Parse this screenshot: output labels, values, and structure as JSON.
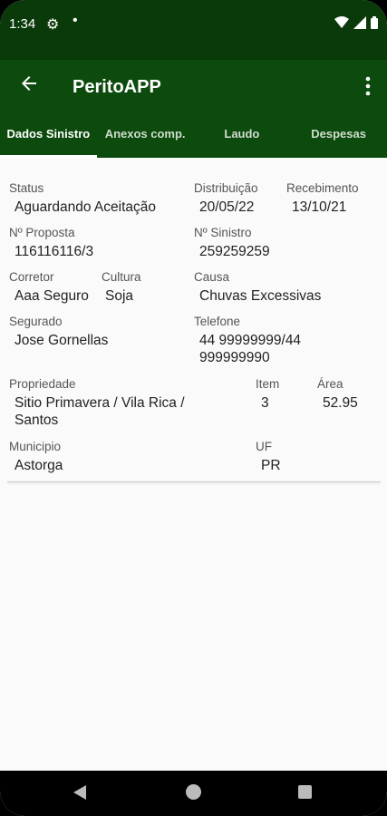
{
  "status_bar": {
    "time": "1:34"
  },
  "app_bar": {
    "title": "PeritoAPP"
  },
  "tabs": [
    {
      "label": "Dados Sinistro",
      "active": true
    },
    {
      "label": "Anexos comp."
    },
    {
      "label": "Laudo"
    },
    {
      "label": "Despesas"
    }
  ],
  "fields": {
    "status": {
      "label": "Status",
      "value": "Aguardando Aceitação"
    },
    "distribuicao": {
      "label": "Distribuição",
      "value": "20/05/22"
    },
    "recebimento": {
      "label": "Recebimento",
      "value": "13/10/21"
    },
    "proposta": {
      "label": "Nº Proposta",
      "value": "116116116/3"
    },
    "sinistro": {
      "label": "Nº Sinistro",
      "value": "259259259"
    },
    "corretor": {
      "label": "Corretor",
      "value": "Aaa Seguro"
    },
    "cultura": {
      "label": "Cultura",
      "value": "Soja"
    },
    "causa": {
      "label": "Causa",
      "value": "Chuvas Excessivas"
    },
    "segurado": {
      "label": "Segurado",
      "value": "Jose Gornellas"
    },
    "telefone": {
      "label": "Telefone",
      "value_line1": "44 99999999/44",
      "value_line2": "999999990"
    },
    "propriedade": {
      "label": "Propriedade",
      "value_line1": "Sitio Primavera / Vila Rica /",
      "value_line2": "Santos"
    },
    "item": {
      "label": "Item",
      "value": "3"
    },
    "area": {
      "label": "Área",
      "value": "52.95"
    },
    "municipio": {
      "label": "Municipio",
      "value": "Astorga"
    },
    "uf": {
      "label": "UF",
      "value": "PR"
    }
  },
  "colors": {
    "toolbar": "#0d4a0d",
    "status_bar": "#0a3a0a"
  }
}
